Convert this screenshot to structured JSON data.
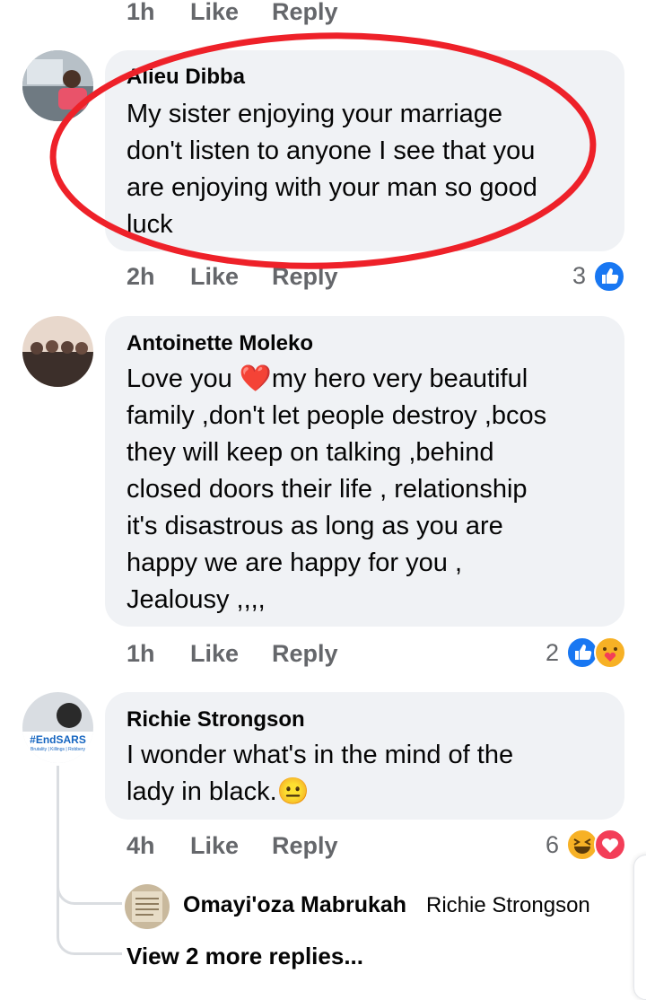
{
  "top_meta": {
    "time": "1h",
    "like": "Like",
    "reply": "Reply"
  },
  "comments": [
    {
      "author": "Alieu Dibba",
      "lines": [
        "My sister enjoying your marriage",
        "don't listen to anyone I see that you",
        "are enjoying with your man so good",
        "luck"
      ],
      "time": "2h",
      "like": "Like",
      "reply": "Reply",
      "reaction_count": "3",
      "reactions": [
        "like-reaction-icon"
      ]
    },
    {
      "author": "Antoinette Moleko",
      "lines": [
        "Love you ❤️my hero very beautiful",
        "family ,don't let people destroy ,bcos",
        "they will keep on talking ,behind",
        "closed doors their life , relationship",
        "it's disastrous as long as you are",
        "happy we are happy for you ,",
        "Jealousy  ,,,,"
      ],
      "time": "1h",
      "like": "Like",
      "reply": "Reply",
      "reaction_count": "2",
      "reactions": [
        "like-reaction-icon",
        "care-reaction-icon"
      ]
    },
    {
      "author": "Richie Strongson",
      "lines": [
        "I wonder what's in the mind of the",
        "lady in black.😐"
      ],
      "time": "4h",
      "like": "Like",
      "reply": "Reply",
      "reaction_count": "6",
      "reactions": [
        "haha-reaction-icon",
        "love-reaction-icon"
      ],
      "avatar_badge": "#EndSARS",
      "avatar_badge_sub": "Brutality | Killings | Robbery"
    }
  ],
  "reply_preview": {
    "author": "Omayi'oza Mabrukah",
    "mention": "Richie Strongson"
  },
  "view_more": "View 2 more replies...",
  "colors": {
    "bubble": "#f0f2f5",
    "meta": "#65676b",
    "like_blue": "#1877f2",
    "love_red": "#f33e58",
    "annotation_red": "#ee2129"
  }
}
